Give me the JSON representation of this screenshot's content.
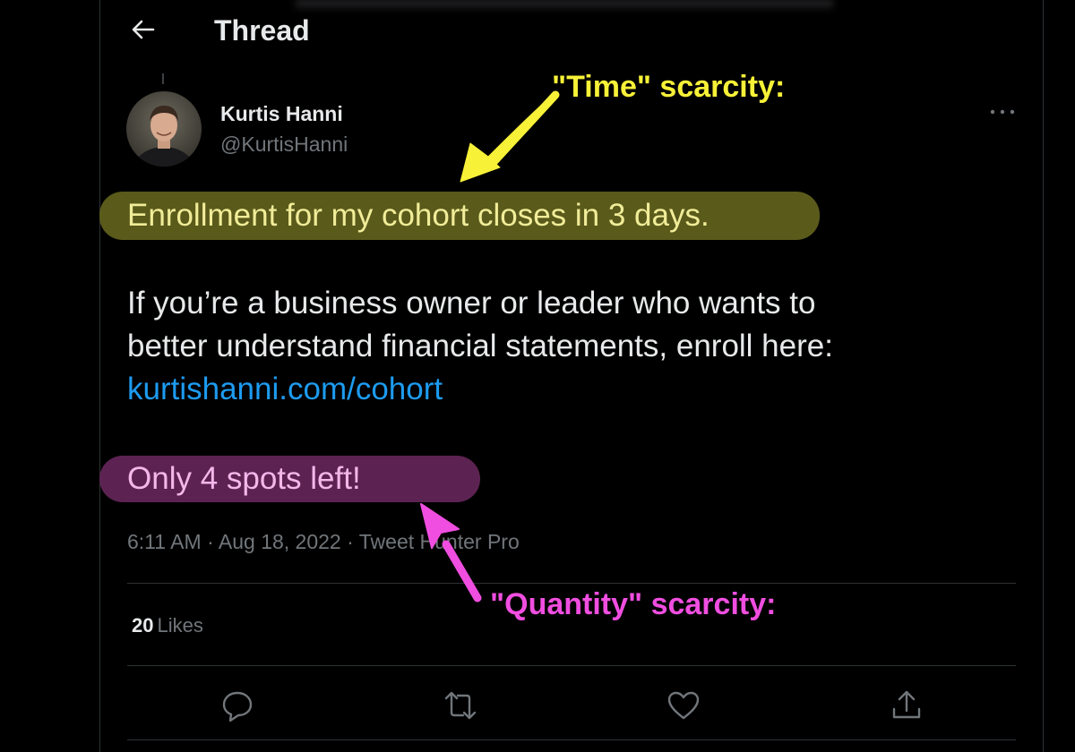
{
  "header": {
    "title": "Thread"
  },
  "tweet": {
    "author_name": "Kurtis Hanni",
    "author_handle": "@KurtisHanni",
    "line_time": "Enrollment for my cohort closes in 3 days.",
    "body_line1": "If you’re a business owner or leader who wants to",
    "body_line2": "better understand financial statements, enroll here:",
    "link": "kurtishanni.com/cohort",
    "line_quantity": "Only 4 spots left!",
    "time": "6:11 AM",
    "date": "Aug 18, 2022",
    "separator": "·",
    "source": "Tweet Hunter Pro",
    "likes_count": "20",
    "likes_label": "Likes"
  },
  "annotations": {
    "time_label": "\"Time\" scarcity:",
    "quantity_label": "\"Quantity\" scarcity:"
  },
  "colors": {
    "background": "#000000",
    "link": "#1d9bf0",
    "time_highlight": "#5a5a1b",
    "quantity_highlight": "#5c2352",
    "time_annotation": "#f7f138",
    "quantity_annotation": "#f04ee0",
    "muted_text": "#71767b"
  },
  "icons": {
    "back": "arrow-left-icon",
    "more": "more-dots-icon",
    "reply": "reply-bubble-icon",
    "retweet": "retweet-icon",
    "like": "heart-icon",
    "share": "share-upload-icon"
  }
}
